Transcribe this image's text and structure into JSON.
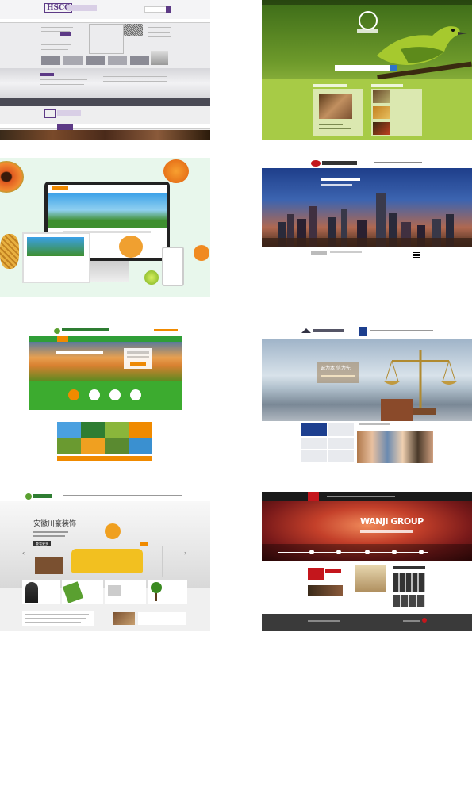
{
  "thumbnails": [
    {
      "id": "t1",
      "logo": "HSCC"
    },
    {
      "id": "t2",
      "search_placeholder": ""
    },
    {
      "id": "t3",
      "brand": ""
    },
    {
      "id": "t4",
      "skyline_caption": ""
    },
    {
      "id": "t5",
      "phone": ""
    },
    {
      "id": "t6",
      "slogan": "诚为本 信为先"
    },
    {
      "id": "t7",
      "headline": "安徽川豪装饰",
      "cta": "查看更多"
    },
    {
      "id": "t8",
      "brand": "WANJI GROUP"
    }
  ],
  "colors": {
    "purple": "#5d3a86",
    "leaf_green": "#8ab63b",
    "orange": "#f08a00",
    "navy": "#1d3f8f",
    "red": "#c4161c"
  }
}
